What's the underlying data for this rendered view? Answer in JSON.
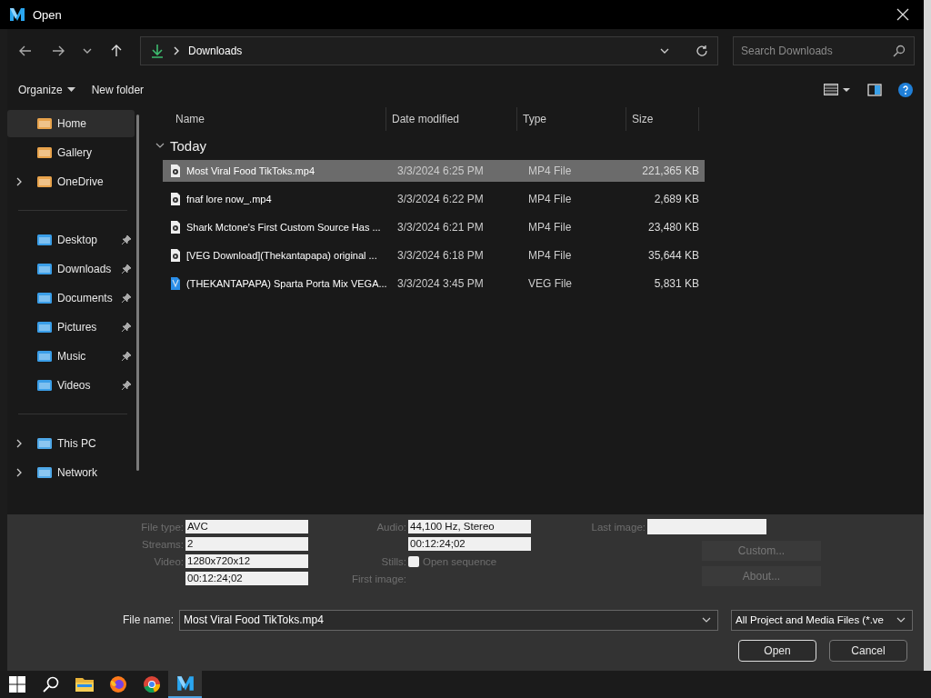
{
  "window": {
    "title": "Open"
  },
  "address": {
    "location": "Downloads"
  },
  "search": {
    "placeholder": "Search Downloads"
  },
  "toolbar": {
    "organize": "Organize",
    "new_folder": "New folder"
  },
  "sidebar": {
    "sections": [
      [
        {
          "label": "Home",
          "kind": "plain",
          "selected": true
        },
        {
          "label": "Gallery",
          "kind": "plain",
          "selected": false
        },
        {
          "label": "OneDrive",
          "kind": "expandable",
          "selected": false
        }
      ],
      [
        {
          "label": "Desktop",
          "kind": "pinned",
          "selected": false
        },
        {
          "label": "Downloads",
          "kind": "pinned",
          "selected": false
        },
        {
          "label": "Documents",
          "kind": "pinned",
          "selected": false
        },
        {
          "label": "Pictures",
          "kind": "pinned",
          "selected": false
        },
        {
          "label": "Music",
          "kind": "pinned",
          "selected": false
        },
        {
          "label": "Videos",
          "kind": "pinned",
          "selected": false
        }
      ],
      [
        {
          "label": "This PC",
          "kind": "expandable",
          "selected": false
        },
        {
          "label": "Network",
          "kind": "expandable",
          "selected": false
        }
      ]
    ]
  },
  "table": {
    "columns": [
      "Name",
      "Date modified",
      "Type",
      "Size"
    ],
    "group": {
      "label": "Today",
      "expanded": true
    },
    "rows": [
      {
        "name": "Most Viral Food TikToks.mp4",
        "date": "3/3/2024 6:25 PM",
        "type": "MP4 File",
        "size": "221,365 KB",
        "kind": "video",
        "selected": true
      },
      {
        "name": "fnaf lore now_.mp4",
        "date": "3/3/2024 6:22 PM",
        "type": "MP4 File",
        "size": "2,689 KB",
        "kind": "video",
        "selected": false
      },
      {
        "name": "Shark Mctone's First Custom Source Has ...",
        "date": "3/3/2024 6:21 PM",
        "type": "MP4 File",
        "size": "23,480 KB",
        "kind": "video",
        "selected": false
      },
      {
        "name": "[VEG Download](Thekantapapa) original ...",
        "date": "3/3/2024 6:18 PM",
        "type": "MP4 File",
        "size": "35,644 KB",
        "kind": "video",
        "selected": false
      },
      {
        "name": "(THEKANTAPAPA) Sparta Porta Mix VEGA...",
        "date": "3/3/2024 3:45 PM",
        "type": "VEG File",
        "size": "5,831 KB",
        "kind": "project",
        "selected": false
      }
    ]
  },
  "properties": {
    "left": [
      {
        "label": "File type:",
        "value": "AVC"
      },
      {
        "label": "Streams:",
        "value": "2"
      },
      {
        "label": "Video:",
        "value": "1280x720x12"
      },
      {
        "value": "00:12:24;02"
      }
    ],
    "middle": [
      {
        "label": "Audio:",
        "value": "44,100 Hz, Stereo",
        "kind": "field"
      },
      {
        "value": "00:12:24;02",
        "kind": "field"
      },
      {
        "label": "Stills:",
        "checkbox": "Open sequence",
        "checked": false,
        "kind": "check"
      },
      {
        "label": "First image:",
        "kind": "label"
      }
    ],
    "last_image": {
      "label": "Last image:"
    },
    "buttons": [
      "Custom...",
      "About..."
    ]
  },
  "file_name": {
    "label": "File name:",
    "value": "Most Viral Food TikToks.mp4"
  },
  "file_type": {
    "value": "All Project and Media Files (*.ve"
  },
  "actions": [
    "Open",
    "Cancel"
  ],
  "taskbar": {
    "apps": [
      {
        "kind": "start",
        "selected": false
      },
      {
        "kind": "search",
        "selected": false
      },
      {
        "kind": "folder",
        "selected": false
      },
      {
        "kind": "firefox",
        "selected": false
      },
      {
        "kind": "chrome",
        "selected": false
      },
      {
        "kind": "vegas",
        "selected": true
      }
    ]
  }
}
